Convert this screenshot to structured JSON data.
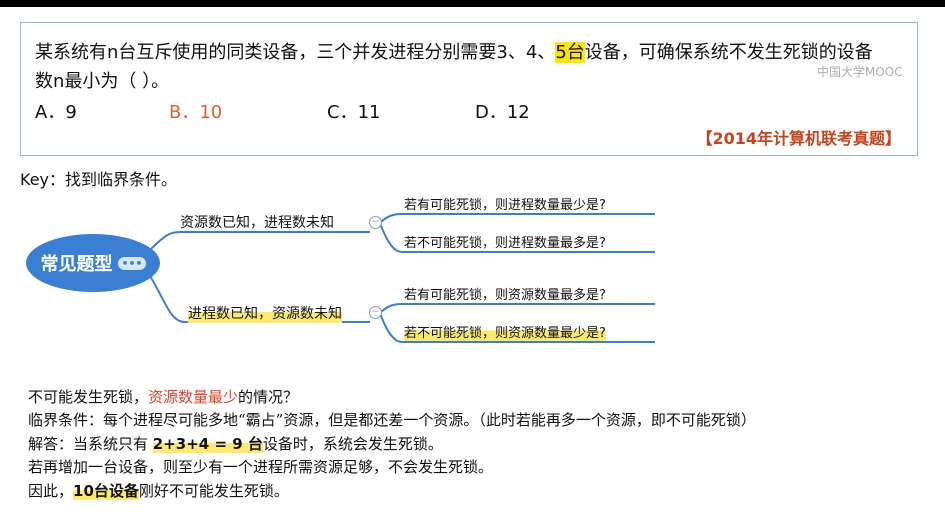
{
  "question": {
    "line1_a": "某系统有n台互斥使用的同类设备，三个并发进程分别需要3、4、",
    "line1_hl": "5台",
    "line1_b": "设备，可确保系统不发生死锁的设备",
    "line2": "数n最小为（    ）。",
    "options": [
      {
        "text": "A．9",
        "color": "#111111"
      },
      {
        "text": "B．10",
        "color": "#e0602a"
      },
      {
        "text": "C．11",
        "color": "#111111"
      },
      {
        "text": "D．12",
        "color": "#111111"
      }
    ],
    "source": "【2014年计算机联考真题】",
    "watermark": "中国大学MOOC"
  },
  "key": "Key：找到临界条件。",
  "mindmap": {
    "root": "常见题型",
    "branch1": "资源数已知，进程数未知",
    "branch2": "进程数已知，资源数未知",
    "leaves": [
      "若有可能死锁，则进程数量最少是?",
      "若不可能死锁，则进程数量最多是?",
      "若有可能死锁，则资源数量最多是?",
      "若不可能死锁，则资源数量最少是?"
    ],
    "collapse_symbol": "−"
  },
  "explanation": {
    "l1_a": "不可能发生死锁，",
    "l1_red": "资源数量最少",
    "l1_b": "的情况？",
    "l2": "临界条件：每个进程尽可能多地“霸占”资源，但是都还差一个资源。（此时若能再多一个资源，即不可能死锁）",
    "l3_a": "解答：当系统只有 ",
    "l3_bold": "2+3+4 = 9 台",
    "l3_b": "设备时，系统会发生死锁。",
    "l4": "若再增加一台设备，则至少有一个进程所需资源足够，不会发生死锁。",
    "l5_a": "因此，",
    "l5_bold": "10台设备",
    "l5_b": "刚好不可能发生死锁。"
  }
}
